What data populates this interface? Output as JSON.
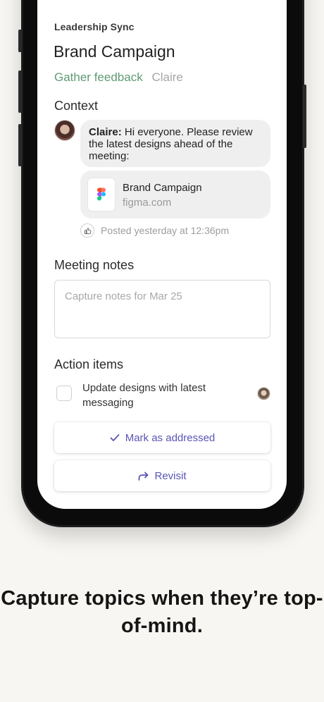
{
  "meeting": {
    "name": "Leadership Sync"
  },
  "topic": {
    "title": "Brand Campaign",
    "status": "Gather feedback",
    "owner": "Claire"
  },
  "context": {
    "heading": "Context",
    "message": {
      "author": "Claire:",
      "text": " Hi everyone. Please review the latest designs ahead of the meeting:"
    },
    "link": {
      "title": "Brand Campaign",
      "domain": "figma.com",
      "icon": "figma-icon"
    },
    "posted": "Posted yesterday at 12:36pm"
  },
  "notes": {
    "heading": "Meeting notes",
    "placeholder": "Capture notes for Mar 25"
  },
  "action_items": {
    "heading": "Action items",
    "items": [
      {
        "text": "Update designs with latest messaging",
        "checked": false
      }
    ]
  },
  "buttons": {
    "mark_addressed": "Mark as addressed",
    "revisit": "Revisit"
  },
  "tagline": "Capture topics when they’re top-of-mind.",
  "colors": {
    "accent": "#5a55b5",
    "status_green": "#5f9b73",
    "background": "#f7f6f2"
  }
}
